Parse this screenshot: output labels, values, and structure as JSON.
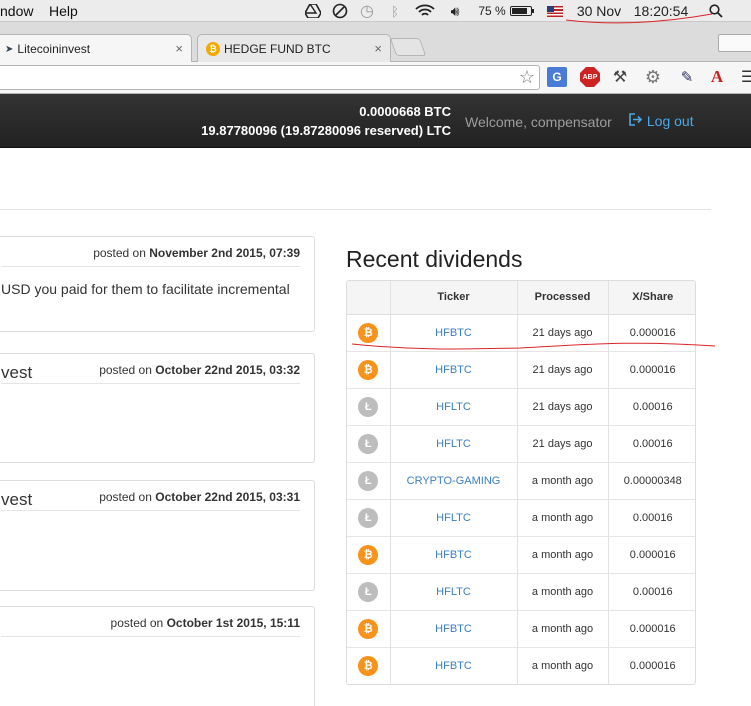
{
  "menubar": {
    "left_items": [
      "ndow",
      "Help"
    ],
    "battery_percent": "75 %",
    "date": "30 Nov",
    "time": "18:20:54"
  },
  "browser": {
    "tabs": [
      {
        "title": "Litecoininvest",
        "favicon": "litecoin-logo-icon",
        "active": true
      },
      {
        "title": "HEDGE FUND BTC",
        "favicon": "bitcoin-icon",
        "active": false
      }
    ],
    "close_glyph": "×",
    "extensions": {
      "translate": "G",
      "adblock": "ABP",
      "font": "A"
    }
  },
  "navbar": {
    "btc_balance": "0.0000668 BTC",
    "ltc_balance": "19.87780096 (19.87280096 reserved) LTC",
    "welcome": "Welcome, compensator",
    "logout": "Log out"
  },
  "posts": [
    {
      "title": "",
      "posted_prefix": "posted on",
      "date": "November 2nd 2015, 07:39",
      "body": "USD you paid for them to facilitate incremental"
    },
    {
      "title": "vest",
      "posted_prefix": "posted on",
      "date": "October 22nd 2015, 03:32",
      "body": ""
    },
    {
      "title": "vest",
      "posted_prefix": "posted on",
      "date": "October 22nd 2015, 03:31",
      "body": ""
    },
    {
      "title": "",
      "posted_prefix": "posted on",
      "date": "October 1st 2015, 15:11",
      "body": ""
    }
  ],
  "dividends": {
    "heading": "Recent dividends",
    "columns": [
      "",
      "Ticker",
      "Processed",
      "X/Share"
    ],
    "rows": [
      {
        "coin": "btc",
        "ticker": "HFBTC",
        "processed": "21 days ago",
        "xshare": "0.000016"
      },
      {
        "coin": "btc",
        "ticker": "HFBTC",
        "processed": "21 days ago",
        "xshare": "0.000016"
      },
      {
        "coin": "ltc",
        "ticker": "HFLTC",
        "processed": "21 days ago",
        "xshare": "0.00016"
      },
      {
        "coin": "ltc",
        "ticker": "HFLTC",
        "processed": "21 days ago",
        "xshare": "0.00016"
      },
      {
        "coin": "ltc",
        "ticker": "CRYPTO-GAMING",
        "processed": "a month ago",
        "xshare": "0.00000348"
      },
      {
        "coin": "ltc",
        "ticker": "HFLTC",
        "processed": "a month ago",
        "xshare": "0.00016"
      },
      {
        "coin": "btc",
        "ticker": "HFBTC",
        "processed": "a month ago",
        "xshare": "0.000016"
      },
      {
        "coin": "ltc",
        "ticker": "HFLTC",
        "processed": "a month ago",
        "xshare": "0.00016"
      },
      {
        "coin": "btc",
        "ticker": "HFBTC",
        "processed": "a month ago",
        "xshare": "0.000016"
      },
      {
        "coin": "btc",
        "ticker": "HFBTC",
        "processed": "a month ago",
        "xshare": "0.000016"
      }
    ],
    "coin_glyphs": {
      "btc": "₿",
      "ltc": "Ł"
    }
  },
  "colors": {
    "accent_link": "#3a7fc1",
    "bitcoin": "#f7931a",
    "litecoin": "#bdbdbd",
    "annotation": "#d9252a"
  }
}
